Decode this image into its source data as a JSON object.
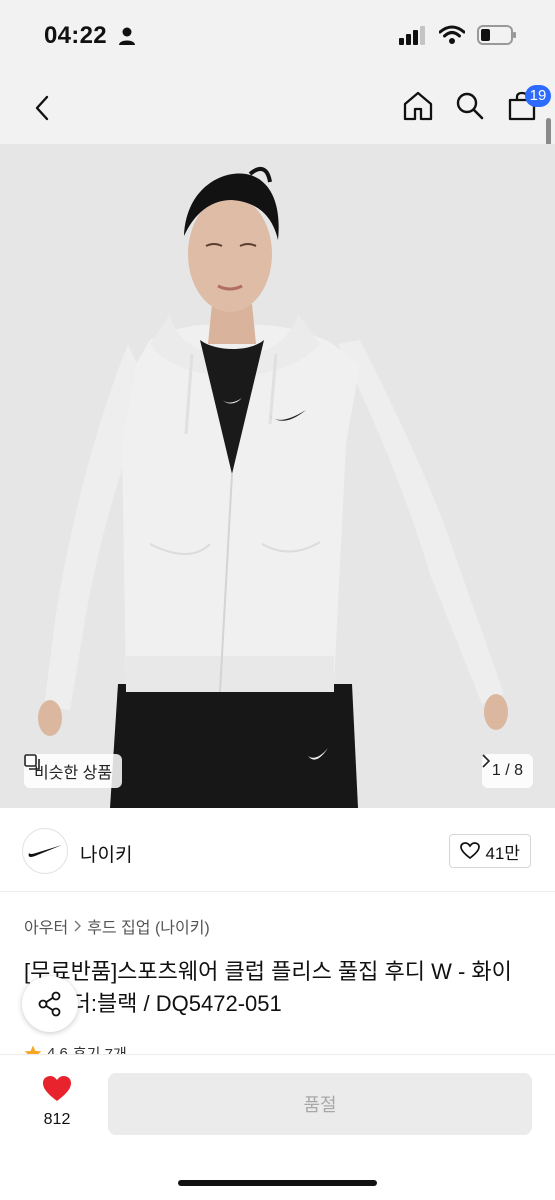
{
  "status_bar": {
    "time": "04:22"
  },
  "nav": {
    "cart_count": "19"
  },
  "gallery": {
    "similar_label": "비슷한 상품",
    "page_counter": "1 / 8"
  },
  "brand": {
    "name": "나이키",
    "like_count": "41만"
  },
  "product": {
    "breadcrumb": [
      "아우터",
      "후드 집업 (나이키)"
    ],
    "title": "[무료반품]스포츠웨어 클럽 플리스 풀집 후디 W - 화이트/헤더:블랙 / DQ5472-051",
    "rating": "4.6",
    "review_label": "후기 7개"
  },
  "bottom_bar": {
    "favorite_count": "812",
    "soldout_label": "품절"
  },
  "colors": {
    "accent": "#2d6bff",
    "heart": "#e8232d",
    "star": "#f5a623"
  }
}
